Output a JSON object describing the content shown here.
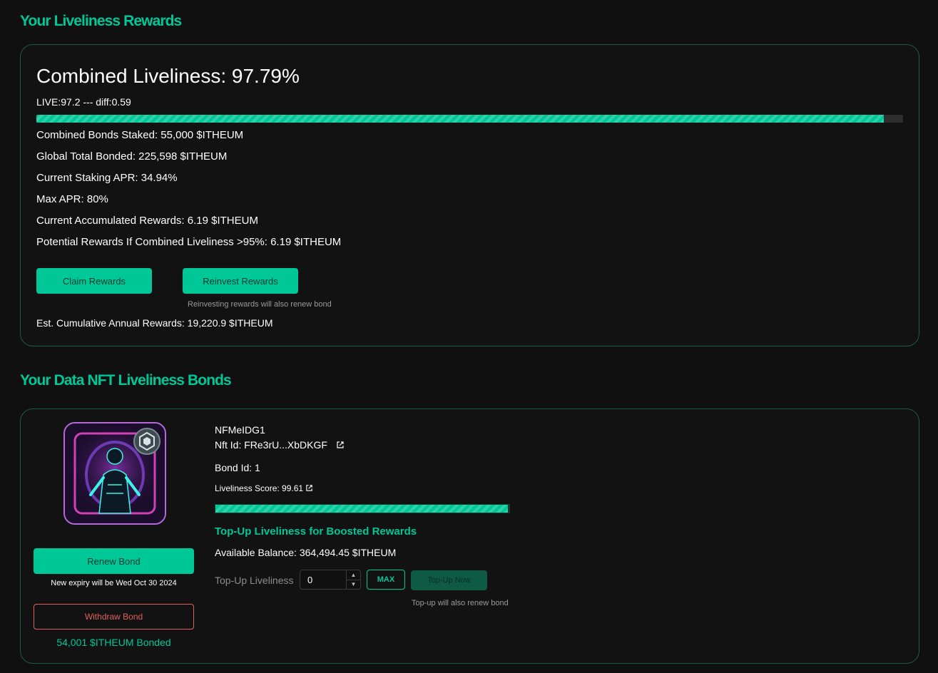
{
  "rewards_section": {
    "title": "Your Liveliness Rewards",
    "combined_liveliness": "Combined Liveliness: 97.79%",
    "live_diff": "LIVE:97.2 --- diff:0.59",
    "progress_percent": 97.79,
    "stats": [
      "Combined Bonds Staked: 55,000 $ITHEUM",
      "Global Total Bonded: 225,598 $ITHEUM",
      "Current Staking APR: 34.94%",
      "Max APR: 80%",
      "Current Accumulated Rewards: 6.19 $ITHEUM",
      "Potential Rewards If Combined Liveliness >95%: 6.19 $ITHEUM"
    ],
    "claim_label": "Claim Rewards",
    "reinvest_label": "Reinvest Rewards",
    "reinvest_note": "Reinvesting rewards will also renew bond",
    "est_annual": "Est. Cumulative Annual Rewards: 19,220.9 $ITHEUM"
  },
  "bonds_section": {
    "title": "Your Data NFT Liveliness Bonds",
    "nft_name": "NFMeIDG1",
    "nft_id": "Nft Id: FRe3rU...XbDKGF",
    "bond_id": "Bond Id: 1",
    "liveliness_score": "Liveliness Score: 99.61",
    "liveliness_percent": 99.61,
    "renew_label": "Renew Bond",
    "renew_note": "New expiry will be Wed Oct 30 2024",
    "withdraw_label": "Withdraw Bond",
    "bonded_amount": "54,001 $ITHEUM Bonded",
    "topup_title": "Top-Up Liveliness for Boosted Rewards",
    "available_balance": "Available Balance: 364,494.45 $ITHEUM",
    "topup_label": "Top-Up Liveliness",
    "topup_value": "0",
    "max_label": "MAX",
    "topup_now_label": "Top-Up Now",
    "topup_note": "Top-up will also renew bond"
  },
  "colors": {
    "accent": "#00c797",
    "background": "#101010",
    "danger": "#e06060"
  },
  "icons": [
    "external-link-icon",
    "spinner-up-icon",
    "spinner-down-icon"
  ]
}
